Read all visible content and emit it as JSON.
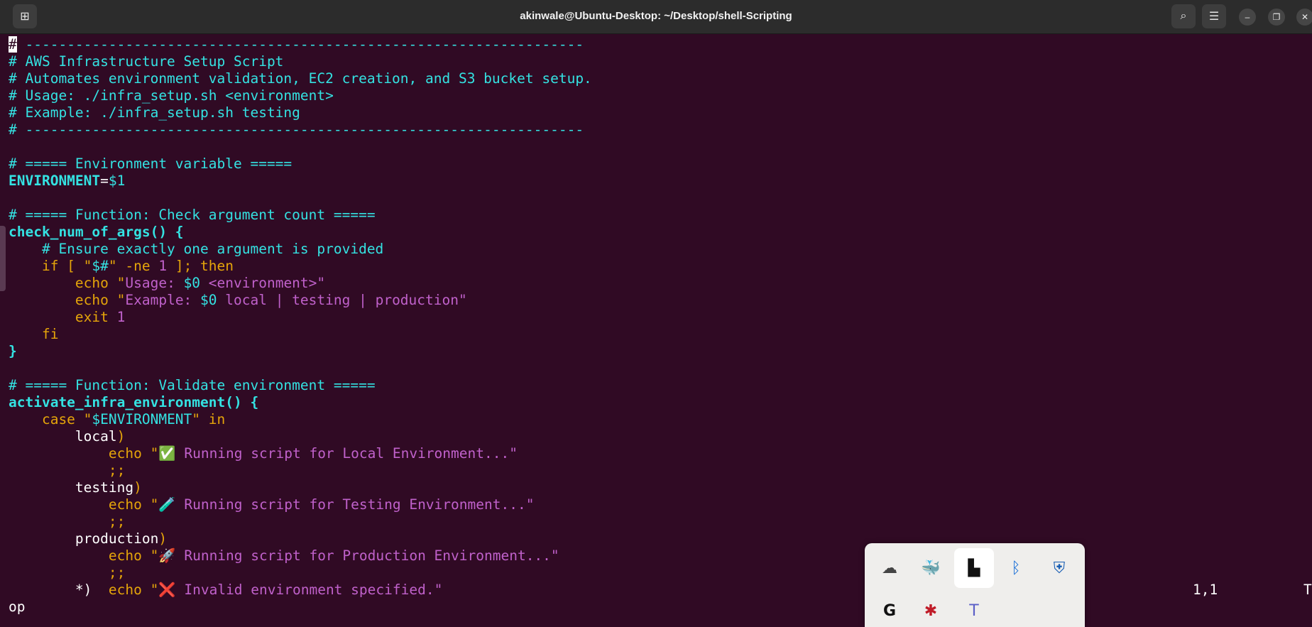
{
  "window": {
    "title": "akinwale@Ubuntu-Desktop: ~/Desktop/shell-Scripting",
    "new_tab_icon": "⊞",
    "search_icon": "⌕",
    "menu_icon": "☰",
    "minimize_icon": "–",
    "restore_icon": "❐",
    "close_icon": "✕"
  },
  "editor": {
    "lines": [
      [
        {
          "t": "#",
          "k": "cursor"
        },
        {
          "t": " -------------------------------------------------------------------",
          "k": "c"
        }
      ],
      [
        {
          "t": "# AWS Infrastructure Setup Script",
          "k": "c"
        }
      ],
      [
        {
          "t": "# Automates environment validation, EC2 creation, and S3 bucket setup.",
          "k": "c"
        }
      ],
      [
        {
          "t": "# Usage: ./infra_setup.sh <environment>",
          "k": "c"
        }
      ],
      [
        {
          "t": "# Example: ./infra_setup.sh testing",
          "k": "c"
        }
      ],
      [
        {
          "t": "# -------------------------------------------------------------------",
          "k": "c"
        }
      ],
      [],
      [
        {
          "t": "# ===== Environment variable =====",
          "k": "c"
        }
      ],
      [
        {
          "t": "ENVIRONMENT",
          "k": "fn"
        },
        {
          "t": "=",
          "k": "pl"
        },
        {
          "t": "$1",
          "k": "var"
        }
      ],
      [],
      [
        {
          "t": "# ===== Function: Check argument count =====",
          "k": "c"
        }
      ],
      [
        {
          "t": "check_num_of_args() {",
          "k": "fn"
        }
      ],
      [
        {
          "t": "    # Ensure exactly one argument is provided",
          "k": "c"
        }
      ],
      [
        {
          "t": "    if [ \"",
          "k": "kw"
        },
        {
          "t": "$#",
          "k": "var"
        },
        {
          "t": "\" -ne ",
          "k": "kw"
        },
        {
          "t": "1",
          "k": "str"
        },
        {
          "t": " ]; then",
          "k": "kw"
        }
      ],
      [
        {
          "t": "        echo \"",
          "k": "kw"
        },
        {
          "t": "Usage: ",
          "k": "str"
        },
        {
          "t": "$0",
          "k": "var"
        },
        {
          "t": " <environment>\"",
          "k": "str"
        }
      ],
      [
        {
          "t": "        echo \"",
          "k": "kw"
        },
        {
          "t": "Example: ",
          "k": "str"
        },
        {
          "t": "$0",
          "k": "var"
        },
        {
          "t": " local | testing | production\"",
          "k": "str"
        }
      ],
      [
        {
          "t": "        exit ",
          "k": "kw"
        },
        {
          "t": "1",
          "k": "str"
        }
      ],
      [
        {
          "t": "    fi",
          "k": "kw"
        }
      ],
      [
        {
          "t": "}",
          "k": "fn"
        }
      ],
      [],
      [
        {
          "t": "# ===== Function: Validate environment =====",
          "k": "c"
        }
      ],
      [
        {
          "t": "activate_infra_environment() {",
          "k": "fn"
        }
      ],
      [
        {
          "t": "    case \"",
          "k": "kw"
        },
        {
          "t": "$ENVIRONMENT",
          "k": "var"
        },
        {
          "t": "\" in",
          "k": "kw"
        }
      ],
      [
        {
          "t": "        local",
          "k": "pl"
        },
        {
          "t": ")",
          "k": "kw"
        }
      ],
      [
        {
          "t": "            echo \"",
          "k": "kw"
        },
        {
          "t": "✅ Running script for Local Environment...\"",
          "k": "str"
        }
      ],
      [
        {
          "t": "            ;;",
          "k": "kw"
        }
      ],
      [
        {
          "t": "        testing",
          "k": "pl"
        },
        {
          "t": ")",
          "k": "kw"
        }
      ],
      [
        {
          "t": "            echo \"",
          "k": "kw"
        },
        {
          "t": "🧪 Running script for Testing Environment...\"",
          "k": "str"
        }
      ],
      [
        {
          "t": "            ;;",
          "k": "kw"
        }
      ],
      [
        {
          "t": "        production",
          "k": "pl"
        },
        {
          "t": ")",
          "k": "kw"
        }
      ],
      [
        {
          "t": "            echo \"",
          "k": "kw"
        },
        {
          "t": "🚀 Running script for Production Environment...\"",
          "k": "str"
        }
      ],
      [
        {
          "t": "            ;;",
          "k": "kw"
        }
      ],
      [
        {
          "t": "        *)  ",
          "k": "pl"
        },
        {
          "t": "echo \"",
          "k": "kw"
        },
        {
          "t": "❌ Invalid environment specified.\"",
          "k": "str"
        }
      ]
    ]
  },
  "status": {
    "position": "1,1",
    "scroll": "T",
    "mode_line": "op"
  },
  "tray": {
    "icons": [
      {
        "name": "cloud-sync-icon",
        "glyph": "☁"
      },
      {
        "name": "docker-icon",
        "glyph": "🐳"
      },
      {
        "name": "bookmark-app-icon",
        "glyph": "▙"
      },
      {
        "name": "bluetooth-icon",
        "glyph": "ᛒ"
      },
      {
        "name": "security-shield-icon",
        "glyph": "⛨"
      },
      {
        "name": "grammarly-icon",
        "glyph": "G"
      },
      {
        "name": "slack-icon",
        "glyph": "✱"
      },
      {
        "name": "teams-icon",
        "glyph": "T"
      }
    ]
  },
  "colors": {
    "background": "#300a24",
    "comment": "#34e2e2",
    "keyword": "#e5a50a",
    "string": "#c061cb"
  }
}
